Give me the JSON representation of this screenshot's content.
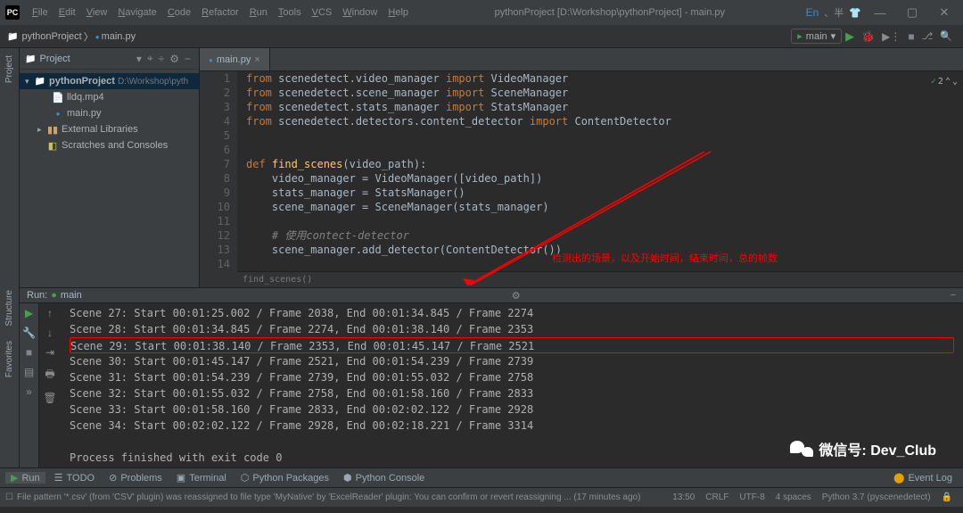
{
  "title_bar": {
    "menu": [
      "File",
      "Edit",
      "View",
      "Navigate",
      "Code",
      "Refactor",
      "Run",
      "Tools",
      "VCS",
      "Window",
      "Help"
    ],
    "title": "pythonProject [D:\\Workshop\\pythonProject] - main.py",
    "lang_indicator": "En",
    "extra_icons": "、半"
  },
  "toolbar": {
    "project_name": "pythonProject",
    "current_file": "main.py",
    "run_config": "main"
  },
  "project_panel": {
    "title": "Project",
    "tree": {
      "root": "pythonProject",
      "root_path": "D:\\Workshop\\pyth",
      "files": [
        "lldq.mp4",
        "main.py"
      ],
      "libs": "External Libraries",
      "scratches": "Scratches and Consoles"
    }
  },
  "editor": {
    "tab_name": "main.py",
    "lines": [
      {
        "n": 1,
        "tokens": [
          [
            "kw",
            "from "
          ],
          [
            "mod",
            "scenedetect.video_manager "
          ],
          [
            "kw",
            "import "
          ],
          [
            "cls",
            "VideoManager"
          ]
        ]
      },
      {
        "n": 2,
        "tokens": [
          [
            "kw",
            "from "
          ],
          [
            "mod",
            "scenedetect.scene_manager "
          ],
          [
            "kw",
            "import "
          ],
          [
            "cls",
            "SceneManager"
          ]
        ]
      },
      {
        "n": 3,
        "tokens": [
          [
            "kw",
            "from "
          ],
          [
            "mod",
            "scenedetect.stats_manager "
          ],
          [
            "kw",
            "import "
          ],
          [
            "cls",
            "StatsManager"
          ]
        ]
      },
      {
        "n": 4,
        "tokens": [
          [
            "kw",
            "from "
          ],
          [
            "mod",
            "scenedetect.detectors.content_detector "
          ],
          [
            "kw",
            "import "
          ],
          [
            "cls",
            "ContentDetector"
          ]
        ]
      },
      {
        "n": 5,
        "tokens": []
      },
      {
        "n": 6,
        "tokens": []
      },
      {
        "n": 7,
        "tokens": [
          [
            "kw",
            "def "
          ],
          [
            "fn",
            "find_scenes"
          ],
          [
            "",
            "(video_path):"
          ]
        ]
      },
      {
        "n": 8,
        "tokens": [
          [
            "",
            "    video_manager = VideoManager([video_path])"
          ]
        ]
      },
      {
        "n": 9,
        "tokens": [
          [
            "",
            "    stats_manager = StatsManager()"
          ]
        ]
      },
      {
        "n": 10,
        "tokens": [
          [
            "",
            "    scene_manager = SceneManager(stats_manager)"
          ]
        ]
      },
      {
        "n": 11,
        "tokens": []
      },
      {
        "n": 12,
        "tokens": [
          [
            "",
            "    "
          ],
          [
            "comment",
            "# 使用contect-detector"
          ]
        ]
      },
      {
        "n": 13,
        "tokens": [
          [
            "",
            "    scene_manager.add_detector(ContentDetector())"
          ]
        ]
      },
      {
        "n": 14,
        "tokens": []
      }
    ],
    "breadcrumb_fn": "find_scenes()",
    "inspections": "2",
    "annotation_text": "检测出的场景，以及开始时间，结束时间，总的帧数"
  },
  "run_panel": {
    "name_label": "Run:",
    "config_name": "main",
    "lines": [
      "Scene 27: Start 00:01:25.002 / Frame 2038, End 00:01:34.845 / Frame 2274",
      "Scene 28: Start 00:01:34.845 / Frame 2274, End 00:01:38.140 / Frame 2353",
      "Scene 29: Start 00:01:38.140 / Frame 2353, End 00:01:45.147 / Frame 2521",
      "Scene 30: Start 00:01:45.147 / Frame 2521, End 00:01:54.239 / Frame 2739",
      "Scene 31: Start 00:01:54.239 / Frame 2739, End 00:01:55.032 / Frame 2758",
      "Scene 32: Start 00:01:55.032 / Frame 2758, End 00:01:58.160 / Frame 2833",
      "Scene 33: Start 00:01:58.160 / Frame 2833, End 00:02:02.122 / Frame 2928",
      "Scene 34: Start 00:02:02.122 / Frame 2928, End 00:02:18.221 / Frame 3314",
      "",
      "Process finished with exit code 0"
    ],
    "highlighted_index": 2
  },
  "bottom_tabs": {
    "run": "Run",
    "todo": "TODO",
    "problems": "Problems",
    "terminal": "Terminal",
    "py_packages": "Python Packages",
    "py_console": "Python Console",
    "event_log": "Event Log"
  },
  "status_bar": {
    "message": "File pattern '*.csv' (from 'CSV' plugin) was reassigned to file type 'MyNative' by 'ExcelReader' plugin: You can confirm or revert reassigning ... (17 minutes ago)",
    "line_col": "13:50",
    "line_ending": "CRLF",
    "encoding": "UTF-8",
    "indent": "4 spaces",
    "interpreter": "Python 3.7 (pyscenedetect)"
  },
  "side_labels": {
    "project": "Project",
    "structure": "Structure",
    "favorites": "Favorites"
  },
  "watermark": "微信号: Dev_Club"
}
